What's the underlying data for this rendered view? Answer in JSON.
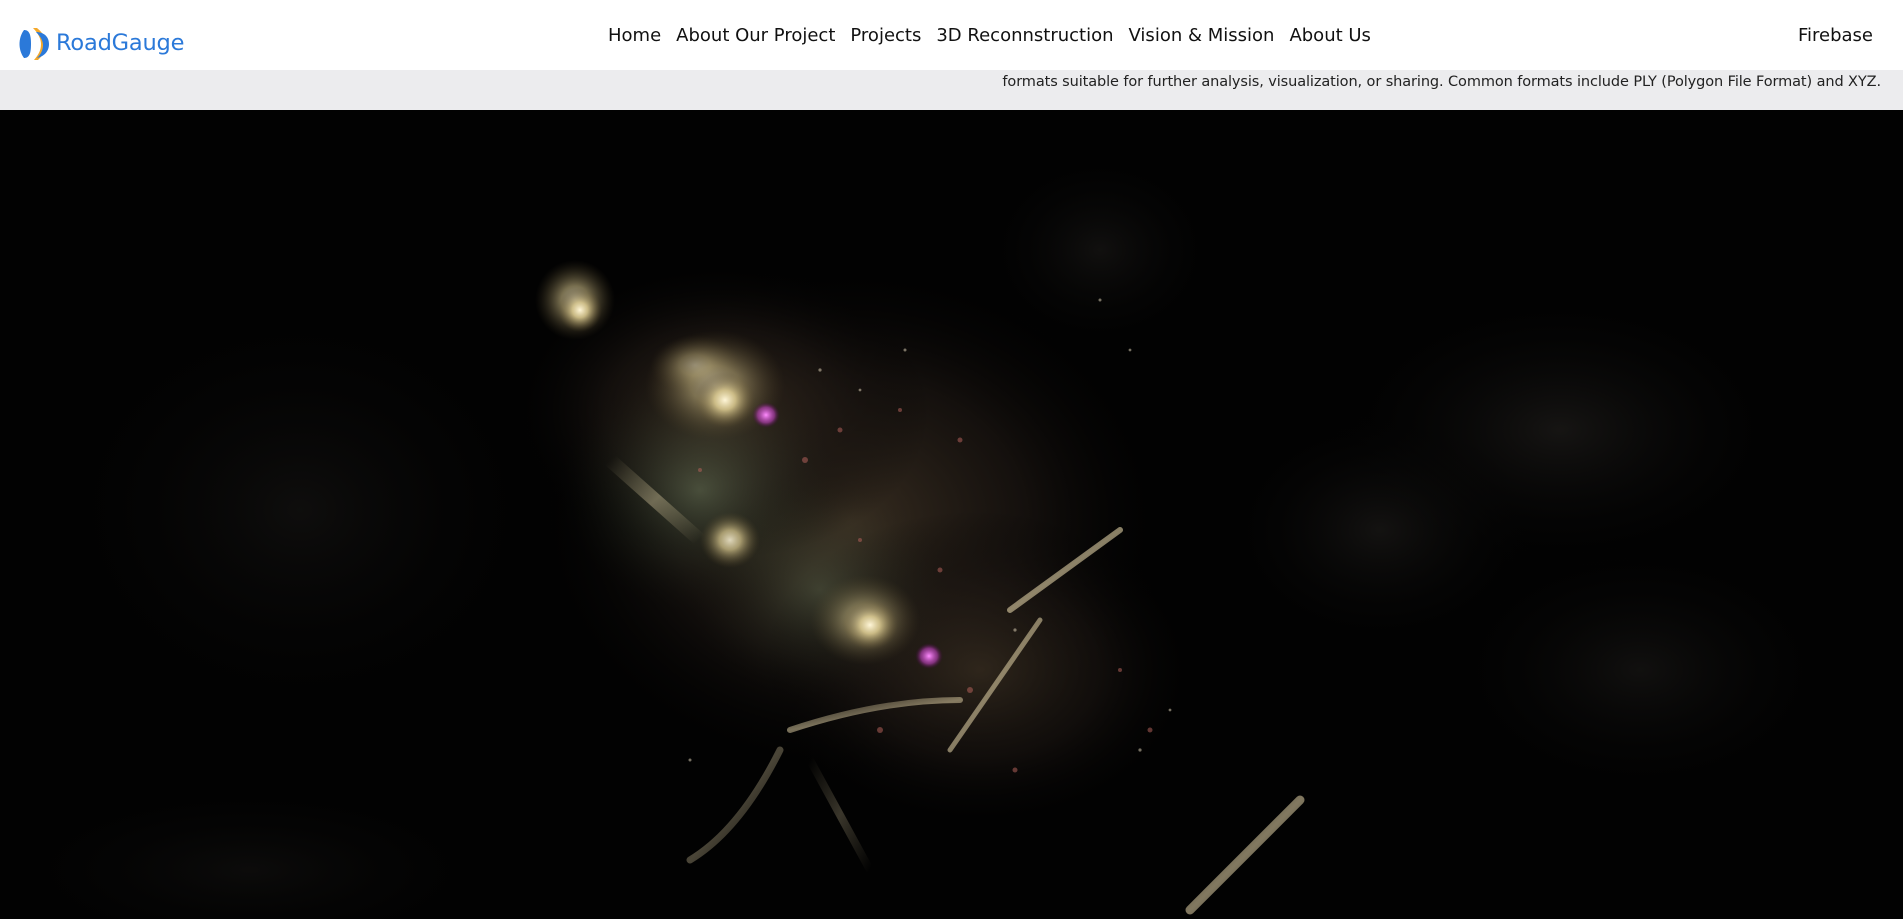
{
  "brand": {
    "name": "RoadGauge",
    "color": "#2b79d9",
    "icon": "roadgauge-logo-icon"
  },
  "nav": {
    "links": [
      {
        "label": "Home"
      },
      {
        "label": "About Our Project"
      },
      {
        "label": "Projects"
      },
      {
        "label": "3D Reconnstruction"
      },
      {
        "label": "Vision & Mission"
      },
      {
        "label": "About Us"
      }
    ],
    "right_label": "Firebase"
  },
  "info": {
    "text": "formats suitable for further analysis, visualization, or sharing. Common formats include PLY (Polygon File Format) and XYZ."
  },
  "colors": {
    "navbar_bg": "#ffffff",
    "strip_bg": "#ececee",
    "video_bg": "#020202"
  }
}
